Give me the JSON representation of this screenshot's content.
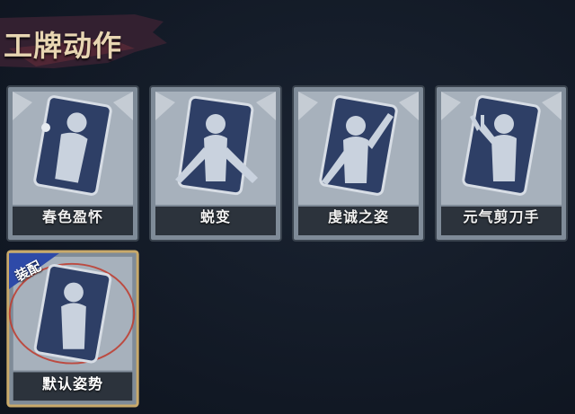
{
  "header": {
    "title": "工牌动作"
  },
  "cards": [
    {
      "label": "春色盈怀",
      "pose": "flower",
      "equipped": false
    },
    {
      "label": "蜕变",
      "pose": "arms-out",
      "equipped": false
    },
    {
      "label": "虔诚之姿",
      "pose": "hand-up",
      "equipped": false
    },
    {
      "label": "元气剪刀手",
      "pose": "peace",
      "equipped": false
    },
    {
      "label": "默认姿势",
      "pose": "default",
      "equipped": true
    }
  ],
  "equip_badge": {
    "label": "装配"
  },
  "colors": {
    "frame": "#8f9aa6",
    "frame_dark": "#4d5763",
    "portrait_bg": "#2e3f66",
    "silhouette": "#c9d2de",
    "equipped_border": "#c9a96a",
    "badge_bg": "#2e4aa8",
    "highlight_ring": "#c0392b"
  }
}
